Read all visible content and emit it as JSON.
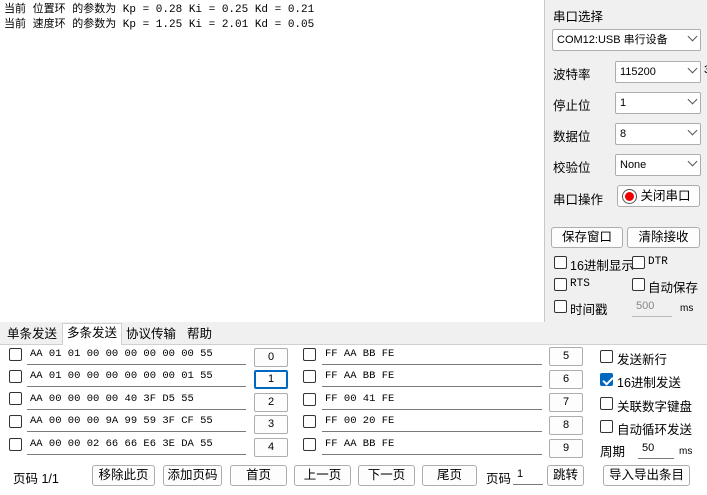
{
  "receive": {
    "lines": [
      "当前 位置环 的参数为 Kp = 0.28 Ki = 0.25 Kd = 0.21",
      "当前 速度环 的参数为 Kp = 1.25 Ki = 2.01 Kd = 0.05"
    ]
  },
  "serial": {
    "port_label": "串口选择",
    "port_value": "COM12:USB 串行设备",
    "baud_label": "波特率",
    "baud_value": "115200",
    "stop_label": "停止位",
    "stop_value": "1",
    "data_label": "数据位",
    "data_value": "8",
    "parity_label": "校验位",
    "parity_value": "None",
    "op_label": "串口操作",
    "op_button": "关闭串口",
    "save_window": "保存窗口",
    "clear_recv": "清除接收",
    "hex_display": "16进制显示",
    "dtr": "DTR",
    "rts": "RTS",
    "auto_save": "自动保存",
    "timestamp": "时间戳",
    "timestamp_value": "500",
    "timestamp_unit": "ms",
    "stray_char": "3"
  },
  "tabs": [
    "单条发送",
    "多条发送",
    "协议传输",
    "帮助"
  ],
  "multi": {
    "left_rows": [
      {
        "text": "AA 01 01 00 00 00 00 00 00 55",
        "index": "0"
      },
      {
        "text": "AA 01 00 00 00 00 00 00 01 55",
        "index": "1"
      },
      {
        "text": "AA 00 00 00 00 40 3F D5 55",
        "index": "2"
      },
      {
        "text": "AA 00 00 00 9A 99 59 3F CF 55",
        "index": "3"
      },
      {
        "text": "AA 00 00 02 66 66 E6 3E DA 55",
        "index": "4"
      }
    ],
    "right_rows": [
      {
        "text": "FF AA BB FE",
        "index": "5"
      },
      {
        "text": "FF AA BB FE",
        "index": "6"
      },
      {
        "text": "FF 00 41 FE",
        "index": "7"
      },
      {
        "text": "FF 00 20 FE",
        "index": "8"
      },
      {
        "text": "FF AA BB FE",
        "index": "9"
      }
    ],
    "opt_newline": "发送新行",
    "opt_hex_send": "16进制发送",
    "opt_keypad": "关联数字键盘",
    "opt_auto_loop": "自动循环发送",
    "period_label": "周期",
    "period_value": "50",
    "period_unit": "ms"
  },
  "footer": {
    "page_code": "页码 1/1",
    "remove_page": "移除此页",
    "add_page": "添加页码",
    "first": "首页",
    "prev": "上一页",
    "next": "下一页",
    "last": "尾页",
    "page_label": "页码",
    "page_input": "1",
    "jump": "跳转",
    "import_export": "导入导出条目"
  }
}
